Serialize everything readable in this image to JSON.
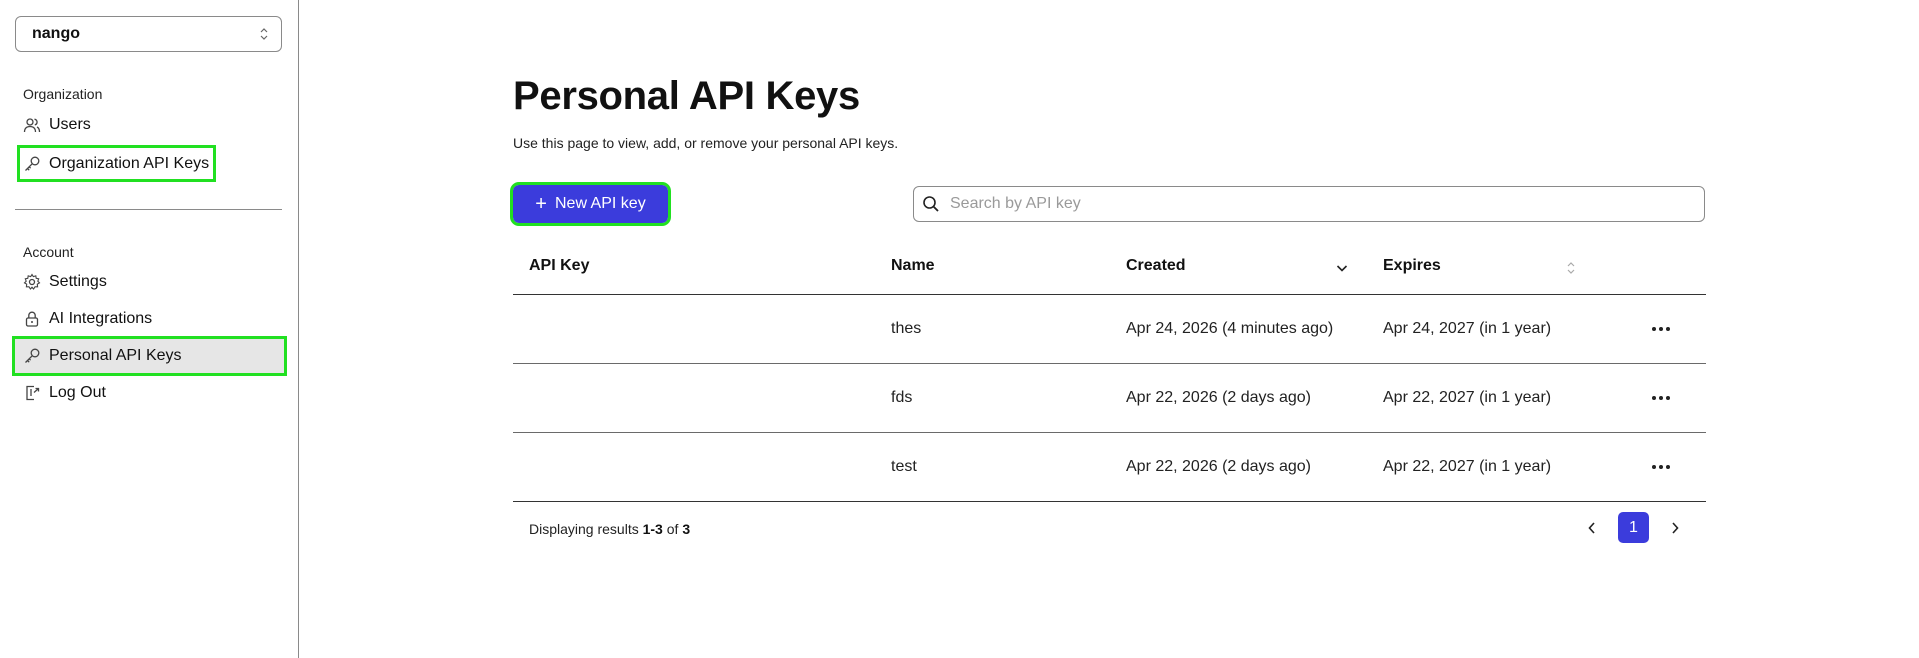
{
  "sidebar": {
    "org_selector_value": "nango",
    "organization_label": "Organization",
    "org_items": [
      {
        "label": "Users",
        "icon": "users-icon"
      },
      {
        "label": "Organization API Keys",
        "icon": "key-icon"
      }
    ],
    "account_label": "Account",
    "account_items": [
      {
        "label": "Settings",
        "icon": "gear-icon"
      },
      {
        "label": "AI Integrations",
        "icon": "lock-icon"
      },
      {
        "label": "Personal API Keys",
        "icon": "key-icon",
        "active": true
      },
      {
        "label": "Log Out",
        "icon": "logout-icon"
      }
    ]
  },
  "main": {
    "title": "Personal API Keys",
    "subtitle": "Use this page to view, add, or remove your personal API keys.",
    "new_key_button": "New API key",
    "search_placeholder": "Search by API key",
    "table": {
      "columns": [
        "API Key",
        "Name",
        "Created",
        "Expires"
      ],
      "rows": [
        {
          "api_key": "",
          "name": "thes",
          "created": "Apr 24, 2026 (4 minutes ago)",
          "expires": "Apr 24, 2027 (in 1 year)"
        },
        {
          "api_key": "",
          "name": "fds",
          "created": "Apr 22, 2026 (2 days ago)",
          "expires": "Apr 22, 2027 (in 1 year)"
        },
        {
          "api_key": "",
          "name": "test",
          "created": "Apr 22, 2026 (2 days ago)",
          "expires": "Apr 22, 2027 (in 1 year)"
        }
      ]
    },
    "footer": {
      "prefix": "Displaying results ",
      "range": "1-3",
      "of": " of ",
      "total": "3"
    },
    "pagination": {
      "current_page": "1"
    }
  },
  "colors": {
    "accent": "#3b3cdc",
    "highlight": "#21e021",
    "active_bg": "#e6e6e6"
  }
}
